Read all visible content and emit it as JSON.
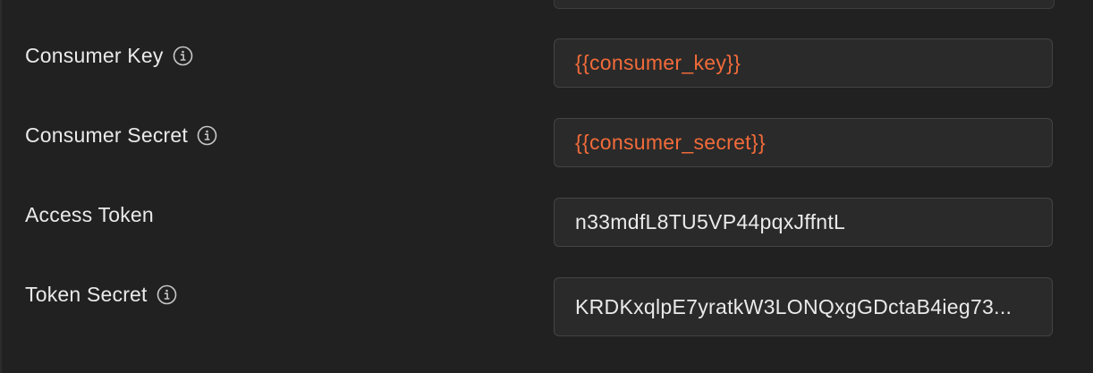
{
  "colors": {
    "background": "#212121",
    "field_background": "#2a2a2a",
    "field_border": "#444444",
    "label_text": "#eaeaea",
    "expression_text": "#f26b3a",
    "icon": "#c8c8c8"
  },
  "fields": [
    {
      "label": "Consumer Key",
      "has_info_icon": true,
      "value": "{{consumer_key}}",
      "value_type": "expression"
    },
    {
      "label": "Consumer Secret",
      "has_info_icon": true,
      "value": "{{consumer_secret}}",
      "value_type": "expression"
    },
    {
      "label": "Access Token",
      "has_info_icon": false,
      "value": "n33mdfL8TU5VP44pqxJffntL",
      "value_type": "plain"
    },
    {
      "label": "Token Secret",
      "has_info_icon": true,
      "value": "KRDKxqlpE7yratkW3LONQxgGDctaB4ieg73...",
      "value_type": "plain"
    }
  ]
}
